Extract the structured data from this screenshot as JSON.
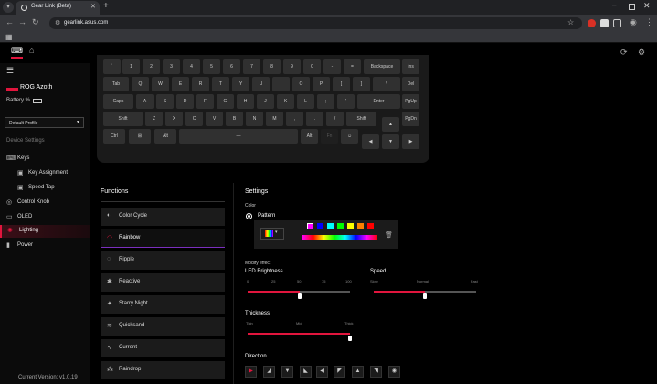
{
  "browser": {
    "tab_title": "Gear Link (Beta)",
    "url": "gearlink.asus.com"
  },
  "sidebar": {
    "device_name": "ROG Azoth",
    "battery_label": "Battery %",
    "profile": "Default Profile",
    "section_title": "Device Settings",
    "items": [
      {
        "label": "Keys",
        "icon": "keyboard-icon"
      },
      {
        "label": "Key Assignment",
        "icon": "key-assignment-icon"
      },
      {
        "label": "Speed Tap",
        "icon": "speed-tap-icon"
      },
      {
        "label": "Control Knob",
        "icon": "knob-icon"
      },
      {
        "label": "OLED",
        "icon": "oled-icon"
      },
      {
        "label": "Lighting",
        "icon": "lighting-icon",
        "active": true
      },
      {
        "label": "Power",
        "icon": "power-icon"
      }
    ],
    "version": "Current Version: v1.0.19"
  },
  "keyboard": {
    "rows": [
      [
        "`",
        "1",
        "2",
        "3",
        "4",
        "5",
        "6",
        "7",
        "8",
        "9",
        "0",
        "-",
        "=",
        "Backspace",
        "Ins"
      ],
      [
        "Tab",
        "Q",
        "W",
        "E",
        "R",
        "T",
        "Y",
        "U",
        "I",
        "O",
        "P",
        "[",
        "]",
        "\\",
        "Del"
      ],
      [
        "Caps",
        "A",
        "S",
        "D",
        "F",
        "G",
        "H",
        "J",
        "K",
        "L",
        ";",
        "'",
        "Enter",
        "PgUp"
      ],
      [
        "Shift",
        "Z",
        "X",
        "C",
        "V",
        "B",
        "N",
        "M",
        ",",
        ".",
        "/",
        "Shift",
        "▲",
        "PgDn"
      ],
      [
        "Ctrl",
        "⊞",
        "Alt",
        "—",
        "Alt",
        "Fn",
        "☺",
        "◀",
        "▼",
        "▶"
      ]
    ]
  },
  "functions": {
    "title": "Functions",
    "items": [
      {
        "label": "Color Cycle",
        "icon": "color-cycle-icon"
      },
      {
        "label": "Rainbow",
        "icon": "rainbow-icon",
        "active": true
      },
      {
        "label": "Ripple",
        "icon": "ripple-icon"
      },
      {
        "label": "Reactive",
        "icon": "reactive-icon"
      },
      {
        "label": "Starry Night",
        "icon": "starry-night-icon"
      },
      {
        "label": "Quicksand",
        "icon": "quicksand-icon"
      },
      {
        "label": "Current",
        "icon": "current-icon"
      },
      {
        "label": "Raindrop",
        "icon": "raindrop-icon"
      }
    ]
  },
  "settings": {
    "title": "Settings",
    "color_label": "Color",
    "pattern_label": "Pattern",
    "swatches": [
      "#ff00ff",
      "#0000ff",
      "#00ffff",
      "#00ff00",
      "#ffff00",
      "#ff8000",
      "#ff0000"
    ],
    "modify_label": "Modify effect",
    "brightness": {
      "title": "LED Brightness",
      "ticks": [
        "0",
        "25",
        "50",
        "75",
        "100"
      ],
      "value": 50
    },
    "speed": {
      "title": "Speed",
      "ticks": [
        "Slow",
        "Normal",
        "Fast"
      ],
      "value": "Normal"
    },
    "thickness": {
      "title": "Thickness",
      "ticks": [
        "Thin",
        "Mid",
        "Thick"
      ],
      "value": "Thick"
    },
    "direction": {
      "title": "Direction",
      "options": [
        "dir-1",
        "dir-2",
        "dir-3",
        "dir-4",
        "dir-5",
        "dir-6",
        "dir-7",
        "dir-8",
        "dir-9"
      ],
      "selected_index": 0
    }
  },
  "colors": {
    "accent": "#e1153d",
    "active_underline": "#7b2fbe"
  }
}
